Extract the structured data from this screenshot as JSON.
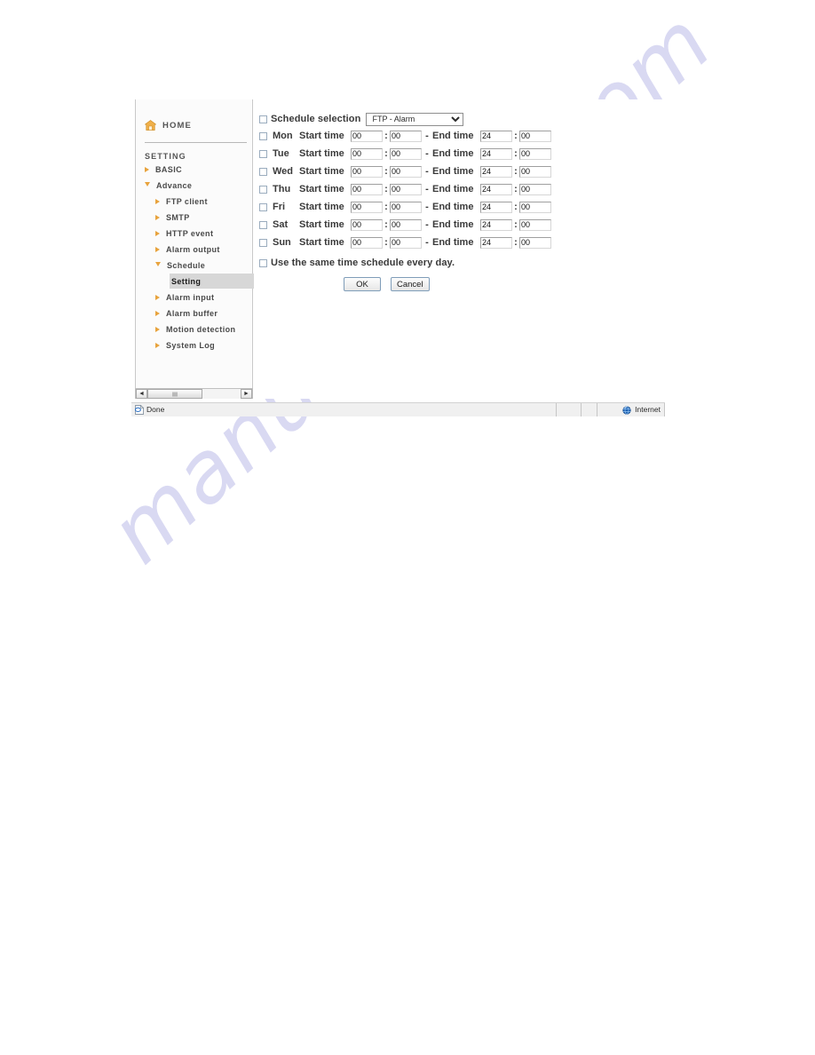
{
  "watermark": {
    "text": "manualshive.com",
    "color": "#d9d9f2"
  },
  "sidebar": {
    "home": {
      "label": "HOME",
      "icon": "home-icon"
    },
    "section_label": "SETTING",
    "items": [
      {
        "label": "BASIC",
        "level": 1,
        "marker": "triangle-right",
        "selected": false
      },
      {
        "label": "Advance",
        "level": 1,
        "marker": "triangle-down",
        "selected": false
      },
      {
        "label": "FTP client",
        "level": 2,
        "marker": "triangle-right",
        "selected": false
      },
      {
        "label": "SMTP",
        "level": 2,
        "marker": "triangle-right",
        "selected": false
      },
      {
        "label": "HTTP event",
        "level": 2,
        "marker": "triangle-right",
        "selected": false
      },
      {
        "label": "Alarm output",
        "level": 2,
        "marker": "triangle-right",
        "selected": false
      },
      {
        "label": "Schedule",
        "level": 2,
        "marker": "triangle-down",
        "selected": false
      },
      {
        "label": "Setting",
        "level": 3,
        "marker": "none",
        "selected": true
      },
      {
        "label": "Alarm input",
        "level": 2,
        "marker": "triangle-right",
        "selected": false
      },
      {
        "label": "Alarm buffer",
        "level": 2,
        "marker": "triangle-right",
        "selected": false
      },
      {
        "label": "Motion detection",
        "level": 2,
        "marker": "triangle-right",
        "selected": false
      },
      {
        "label": "System Log",
        "level": 2,
        "marker": "triangle-right",
        "selected": false
      }
    ],
    "scrollbar": {
      "left_arrow": "◄",
      "right_arrow": "►"
    }
  },
  "form": {
    "schedule_selection": {
      "checkbox_checked": false,
      "label": "Schedule selection",
      "selected_option": "FTP - Alarm",
      "options": [
        "FTP - Alarm"
      ]
    },
    "start_time_label": "Start time",
    "end_time_label": "End time",
    "dash": "-",
    "colon": ":",
    "rows": [
      {
        "day": "Mon",
        "checked": false,
        "start_hour": "00",
        "start_min": "00",
        "end_hour": "24",
        "end_min": "00"
      },
      {
        "day": "Tue",
        "checked": false,
        "start_hour": "00",
        "start_min": "00",
        "end_hour": "24",
        "end_min": "00"
      },
      {
        "day": "Wed",
        "checked": false,
        "start_hour": "00",
        "start_min": "00",
        "end_hour": "24",
        "end_min": "00"
      },
      {
        "day": "Thu",
        "checked": false,
        "start_hour": "00",
        "start_min": "00",
        "end_hour": "24",
        "end_min": "00"
      },
      {
        "day": "Fri",
        "checked": false,
        "start_hour": "00",
        "start_min": "00",
        "end_hour": "24",
        "end_min": "00"
      },
      {
        "day": "Sat",
        "checked": false,
        "start_hour": "00",
        "start_min": "00",
        "end_hour": "24",
        "end_min": "00"
      },
      {
        "day": "Sun",
        "checked": false,
        "start_hour": "00",
        "start_min": "00",
        "end_hour": "24",
        "end_min": "00"
      }
    ],
    "same_schedule": {
      "checkbox_checked": false,
      "label": "Use the same time schedule every day."
    },
    "buttons": {
      "ok": "OK",
      "cancel": "Cancel"
    }
  },
  "statusbar": {
    "status_text": "Done",
    "zone_text": "Internet",
    "page_icon": "ie-page-icon",
    "zone_icon": "globe-icon"
  },
  "colors": {
    "accent_orange": "#e8a33d",
    "selected_bg": "#d7d7d7",
    "sidebar_bg": "#fbfbfb",
    "watermark": "#d9d9f2"
  }
}
